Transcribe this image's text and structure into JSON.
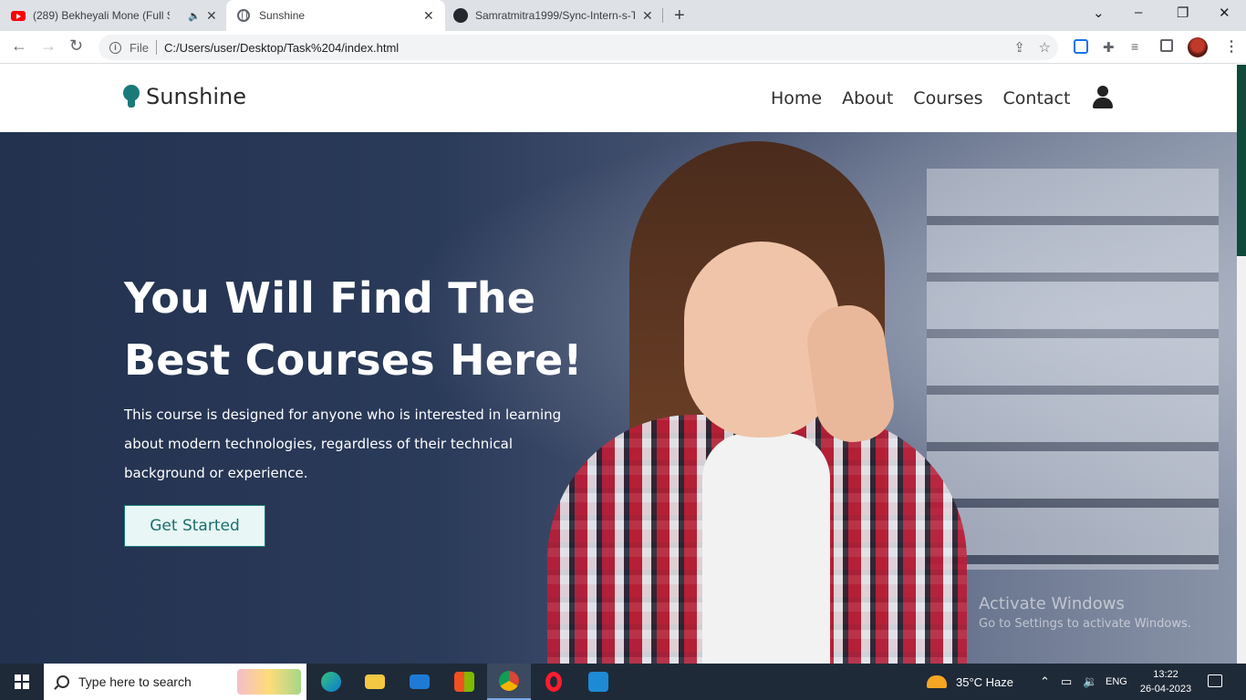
{
  "browser": {
    "tabs": [
      {
        "title": "(289) Bekheyali Mone (Full S",
        "icon": "youtube-icon"
      },
      {
        "title": "Sunshine",
        "icon": "globe-icon"
      },
      {
        "title": "Samratmitra1999/Sync-Intern-s-T",
        "icon": "github-icon"
      }
    ],
    "new_tab": "+",
    "close_glyph": "✕",
    "file_label": "File",
    "url": "C:/Users/user/Desktop/Task%204/index.html"
  },
  "site": {
    "brand": "Sunshine",
    "nav": [
      "Home",
      "About",
      "Courses",
      "Contact"
    ],
    "accent_color": "#1a7a78",
    "hero": {
      "title_line1": "You Will Find The",
      "title_line2": "Best Courses Here!",
      "description": "This course is designed for anyone who is interested in learning about modern technologies, regardless of their technical background or experience.",
      "cta": "Get Started"
    },
    "watermark": {
      "line1": "Activate Windows",
      "line2": "Go to Settings to activate Windows."
    }
  },
  "taskbar": {
    "search_placeholder": "Type here to search",
    "weather": "35°C  Haze",
    "language": "ENG",
    "time": "13:22",
    "date": "26-04-2023"
  }
}
